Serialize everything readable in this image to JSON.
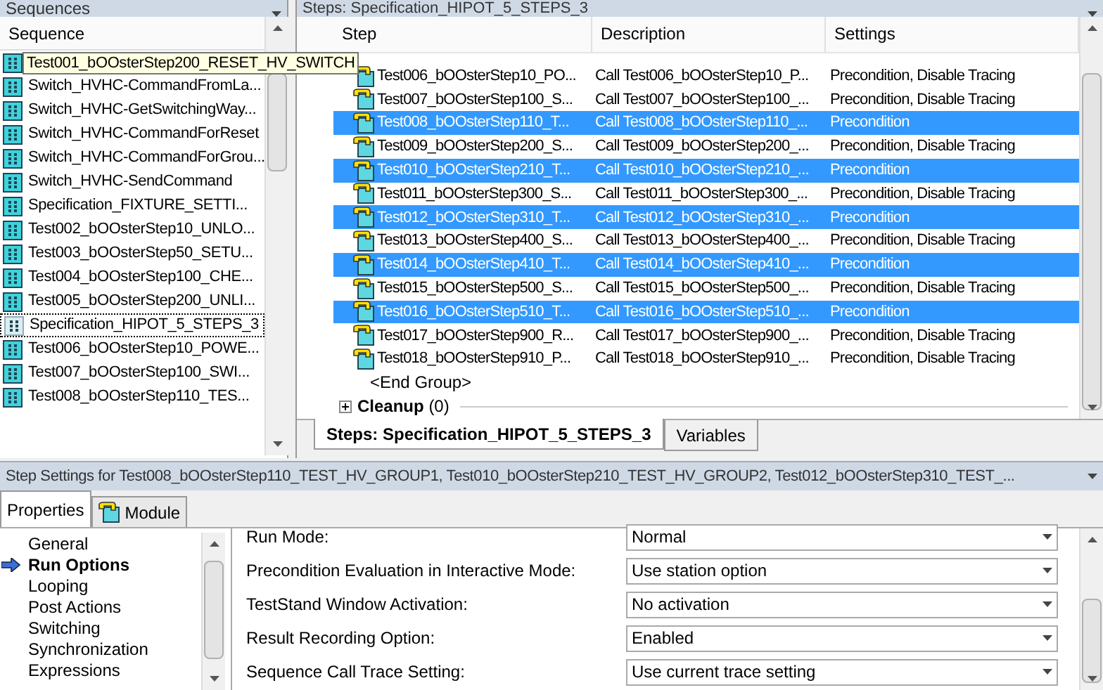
{
  "sequences_panel": {
    "title": "Sequences",
    "column": "Sequence",
    "tooltip": "Test001_bOOsterStep200_RESET_HV_SWITCH",
    "items": [
      {
        "selected": false
      },
      {
        "label": "Switch_HVHC-CommandFromLa...",
        "selected": false
      },
      {
        "label": "Switch_HVHC-GetSwitchingWay...",
        "selected": false
      },
      {
        "label": "Switch_HVHC-CommandForReset",
        "selected": false
      },
      {
        "label": "Switch_HVHC-CommandForGrou...",
        "selected": false
      },
      {
        "label": "Switch_HVHC-SendCommand",
        "selected": false
      },
      {
        "label": "Specification_FIXTURE_SETTI...",
        "selected": false
      },
      {
        "label": "Test002_bOOsterStep10_UNLO...",
        "selected": false
      },
      {
        "label": "Test003_bOOsterStep50_SETU...",
        "selected": false
      },
      {
        "label": "Test004_bOOsterStep100_CHE...",
        "selected": false
      },
      {
        "label": "Test005_bOOsterStep200_UNLI...",
        "selected": false
      },
      {
        "label": "Specification_HIPOT_5_STEPS_3",
        "selected": true
      },
      {
        "label": "Test006_bOOsterStep10_POWE...",
        "selected": false
      },
      {
        "label": "Test007_bOOsterStep100_SWI...",
        "selected": false
      },
      {
        "label": "Test008_bOOsterStep110_TES...",
        "selected": false
      }
    ]
  },
  "steps_panel": {
    "title": "Steps: Specification_HIPOT_5_STEPS_3",
    "columns": [
      "Step",
      "Description",
      "Settings"
    ],
    "rows": [
      {
        "step": "Test006_bOOsterStep10_PO...",
        "description": "Call Test006_bOOsterStep10_P...",
        "settings": "Precondition, Disable Tracing",
        "selected": false
      },
      {
        "step": "Test007_bOOsterStep100_S...",
        "description": "Call Test007_bOOsterStep100_...",
        "settings": "Precondition, Disable Tracing",
        "selected": false
      },
      {
        "step": "Test008_bOOsterStep110_T...",
        "description": "Call Test008_bOOsterStep110_...",
        "settings": "Precondition",
        "selected": true
      },
      {
        "step": "Test009_bOOsterStep200_S...",
        "description": "Call Test009_bOOsterStep200_...",
        "settings": "Precondition, Disable Tracing",
        "selected": false
      },
      {
        "step": "Test010_bOOsterStep210_T...",
        "description": "Call Test010_bOOsterStep210_...",
        "settings": "Precondition",
        "selected": true
      },
      {
        "step": "Test011_bOOsterStep300_S...",
        "description": "Call Test011_bOOsterStep300_...",
        "settings": "Precondition, Disable Tracing",
        "selected": false
      },
      {
        "step": "Test012_bOOsterStep310_T...",
        "description": "Call Test012_bOOsterStep310_...",
        "settings": "Precondition",
        "selected": true
      },
      {
        "step": "Test013_bOOsterStep400_S...",
        "description": "Call Test013_bOOsterStep400_...",
        "settings": "Precondition, Disable Tracing",
        "selected": false
      },
      {
        "step": "Test014_bOOsterStep410_T...",
        "description": "Call Test014_bOOsterStep410_...",
        "settings": "Precondition",
        "selected": true
      },
      {
        "step": "Test015_bOOsterStep500_S...",
        "description": "Call Test015_bOOsterStep500_...",
        "settings": "Precondition, Disable Tracing",
        "selected": false
      },
      {
        "step": "Test016_bOOsterStep510_T...",
        "description": "Call Test016_bOOsterStep510_...",
        "settings": "Precondition",
        "selected": true
      },
      {
        "step": "Test017_bOOsterStep900_R...",
        "description": "Call Test017_bOOsterStep900_...",
        "settings": "Precondition, Disable Tracing",
        "selected": false
      },
      {
        "step": "Test018_bOOsterStep910_P...",
        "description": "Call Test018_bOOsterStep910_...",
        "settings": "Precondition, Disable Tracing",
        "selected": false
      }
    ],
    "end_group": "<End Group>",
    "cleanup": {
      "label": "Cleanup",
      "count": "(0)",
      "expanded": false
    },
    "tabs": [
      {
        "label": "Steps: Specification_HIPOT_5_STEPS_3",
        "selected": true
      },
      {
        "label": "Variables",
        "selected": false
      }
    ]
  },
  "step_settings": {
    "title": "Step Settings for Test008_bOOsterStep110_TEST_HV_GROUP1, Test010_bOOsterStep210_TEST_HV_GROUP2, Test012_bOOsterStep310_TEST_...",
    "tabs": [
      {
        "label": "Properties",
        "selected": true
      },
      {
        "label": "Module",
        "selected": false
      }
    ],
    "nav": [
      {
        "label": "General",
        "selected": false
      },
      {
        "label": "Run Options",
        "selected": true
      },
      {
        "label": "Looping",
        "selected": false
      },
      {
        "label": "Post Actions",
        "selected": false
      },
      {
        "label": "Switching",
        "selected": false
      },
      {
        "label": "Synchronization",
        "selected": false
      },
      {
        "label": "Expressions",
        "selected": false
      }
    ],
    "fields": [
      {
        "label": "Run Mode:",
        "value": "Normal"
      },
      {
        "label": "Precondition Evaluation in Interactive Mode:",
        "value": "Use station option"
      },
      {
        "label": "TestStand Window Activation:",
        "value": "No activation"
      },
      {
        "label": "Result Recording Option:",
        "value": "Enabled"
      },
      {
        "label": "Sequence Call Trace Setting:",
        "value": "Use current trace setting"
      }
    ]
  }
}
